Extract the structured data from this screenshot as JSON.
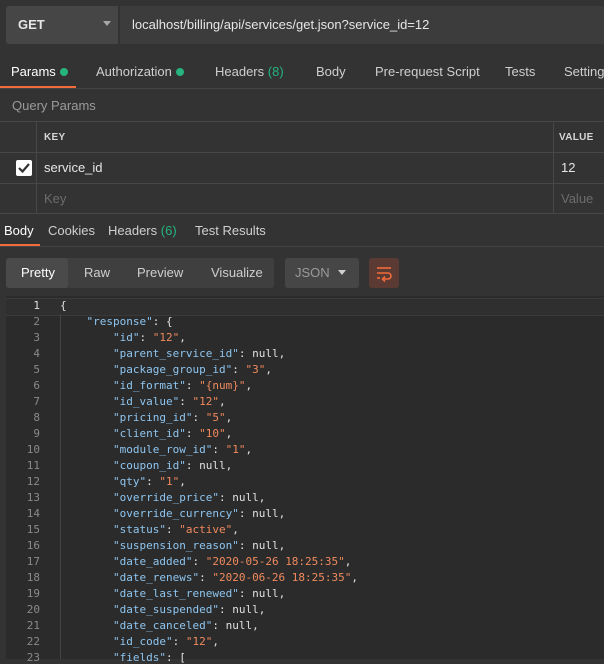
{
  "request": {
    "method": "GET",
    "url": "localhost/billing/api/services/get.json?service_id=12"
  },
  "request_tabs": [
    {
      "label": "Params",
      "dot": true
    },
    {
      "label": "Authorization",
      "dot": true
    },
    {
      "label": "Headers",
      "count": "(8)"
    },
    {
      "label": "Body"
    },
    {
      "label": "Pre-request Script"
    },
    {
      "label": "Tests"
    },
    {
      "label": "Setting"
    }
  ],
  "query_params": {
    "title": "Query Params",
    "headers": {
      "key": "KEY",
      "value": "VALUE"
    },
    "rows": [
      {
        "key": "service_id",
        "value": "12",
        "checked": true
      }
    ],
    "placeholder": {
      "key": "Key",
      "value": "Value"
    }
  },
  "response_tabs": [
    {
      "label": "Body"
    },
    {
      "label": "Cookies"
    },
    {
      "label": "Headers",
      "count": "(6)"
    },
    {
      "label": "Test Results"
    }
  ],
  "view_modes": [
    "Pretty",
    "Raw",
    "Preview",
    "Visualize"
  ],
  "language": "JSON",
  "colors": {
    "accent": "#f26b3a",
    "status_dot": "#26b47f",
    "json_key": "#8ec5f0",
    "json_string": "#f08a5d"
  },
  "code_lines": [
    {
      "n": "1",
      "text": "{"
    },
    {
      "n": "2",
      "text": "    \"response\": {"
    },
    {
      "n": "3",
      "text": "        \"id\": \"12\","
    },
    {
      "n": "4",
      "text": "        \"parent_service_id\": null,"
    },
    {
      "n": "5",
      "text": "        \"package_group_id\": \"3\","
    },
    {
      "n": "6",
      "text": "        \"id_format\": \"{num}\","
    },
    {
      "n": "7",
      "text": "        \"id_value\": \"12\","
    },
    {
      "n": "8",
      "text": "        \"pricing_id\": \"5\","
    },
    {
      "n": "9",
      "text": "        \"client_id\": \"10\","
    },
    {
      "n": "10",
      "text": "        \"module_row_id\": \"1\","
    },
    {
      "n": "11",
      "text": "        \"coupon_id\": null,"
    },
    {
      "n": "12",
      "text": "        \"qty\": \"1\","
    },
    {
      "n": "13",
      "text": "        \"override_price\": null,"
    },
    {
      "n": "14",
      "text": "        \"override_currency\": null,"
    },
    {
      "n": "15",
      "text": "        \"status\": \"active\","
    },
    {
      "n": "16",
      "text": "        \"suspension_reason\": null,"
    },
    {
      "n": "17",
      "text": "        \"date_added\": \"2020-05-26 18:25:35\","
    },
    {
      "n": "18",
      "text": "        \"date_renews\": \"2020-06-26 18:25:35\","
    },
    {
      "n": "19",
      "text": "        \"date_last_renewed\": null,"
    },
    {
      "n": "20",
      "text": "        \"date_suspended\": null,"
    },
    {
      "n": "21",
      "text": "        \"date_canceled\": null,"
    },
    {
      "n": "22",
      "text": "        \"id_code\": \"12\","
    },
    {
      "n": "23",
      "text": "        \"fields\": ["
    }
  ]
}
